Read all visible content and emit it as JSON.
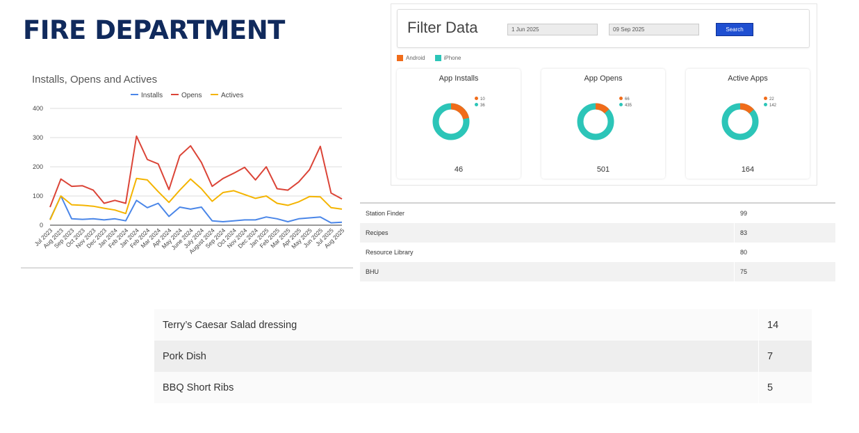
{
  "page": {
    "title": "FIRE DEPARTMENT"
  },
  "colors": {
    "android": "#f06c1a",
    "iphone": "#2cc5b8",
    "installs": "#4a86e8",
    "opens": "#db4437",
    "actives": "#f4b400",
    "search_button": "#1f4fd1"
  },
  "chart_data": {
    "type": "line",
    "title": "Installs, Opens and Actives",
    "xlabel": "",
    "ylabel": "",
    "ylim": [
      0,
      400
    ],
    "yticks": [
      "0",
      "100",
      "200",
      "300",
      "400"
    ],
    "grid": true,
    "legend_position": "top",
    "categories": [
      "Jul 2023",
      "Aug 2023",
      "Sep 2023",
      "Oct 2023",
      "Nov 2023",
      "Dec 2023",
      "Jan 2024",
      "Feb 2024",
      "Jan 2024",
      "Feb 2024",
      "Mar 2024",
      "Apr 2024",
      "May 2024",
      "June 2024",
      "July 2024",
      "August 2024",
      "Sep 2024",
      "Oct 2024",
      "Nov 2024",
      "Dec 2024",
      "Jan 2025",
      "Feb 2025",
      "Mar 2025",
      "Apr 2025",
      "May 2025",
      "Jun 2025",
      "Jul 2025",
      "Aug 2025"
    ],
    "series": [
      {
        "name": "Installs",
        "color": "#4a86e8",
        "values": [
          20,
          100,
          22,
          20,
          22,
          18,
          22,
          15,
          85,
          60,
          75,
          30,
          62,
          55,
          62,
          15,
          12,
          15,
          18,
          18,
          28,
          22,
          12,
          22,
          25,
          28,
          8,
          10
        ]
      },
      {
        "name": "Opens",
        "color": "#db4437",
        "values": [
          62,
          158,
          133,
          135,
          120,
          75,
          85,
          75,
          305,
          225,
          210,
          122,
          238,
          272,
          215,
          133,
          160,
          178,
          198,
          155,
          200,
          125,
          120,
          148,
          190,
          270,
          110,
          90
        ]
      },
      {
        "name": "Actives",
        "color": "#f4b400",
        "values": [
          18,
          100,
          70,
          68,
          65,
          58,
          52,
          40,
          160,
          155,
          115,
          78,
          120,
          158,
          125,
          82,
          112,
          118,
          105,
          92,
          100,
          75,
          68,
          80,
          98,
          97,
          60,
          55
        ]
      }
    ]
  },
  "filter": {
    "title": "Filter Data",
    "start_date": "1 Jun 2025",
    "end_date": "09 Sep 2025",
    "search_label": "Search"
  },
  "legend": {
    "android": "Android",
    "iphone": "iPhone"
  },
  "cards": [
    {
      "title": "App Installs",
      "android": "10",
      "iphone": "36",
      "total": "46"
    },
    {
      "title": "App Opens",
      "android": "66",
      "iphone": "435",
      "total": "501"
    },
    {
      "title": "Active Apps",
      "android": "22",
      "iphone": "142",
      "total": "164"
    }
  ],
  "mid_table": [
    {
      "name": "Station Finder",
      "value": "99"
    },
    {
      "name": "Recipes",
      "value": "83"
    },
    {
      "name": "Resource Library",
      "value": "80"
    },
    {
      "name": "BHU",
      "value": "75"
    }
  ],
  "bottom_table": [
    {
      "name": "Terry’s Caesar Salad dressing",
      "value": "14"
    },
    {
      "name": "Pork Dish",
      "value": "7"
    },
    {
      "name": "BBQ Short Ribs",
      "value": "5"
    }
  ]
}
